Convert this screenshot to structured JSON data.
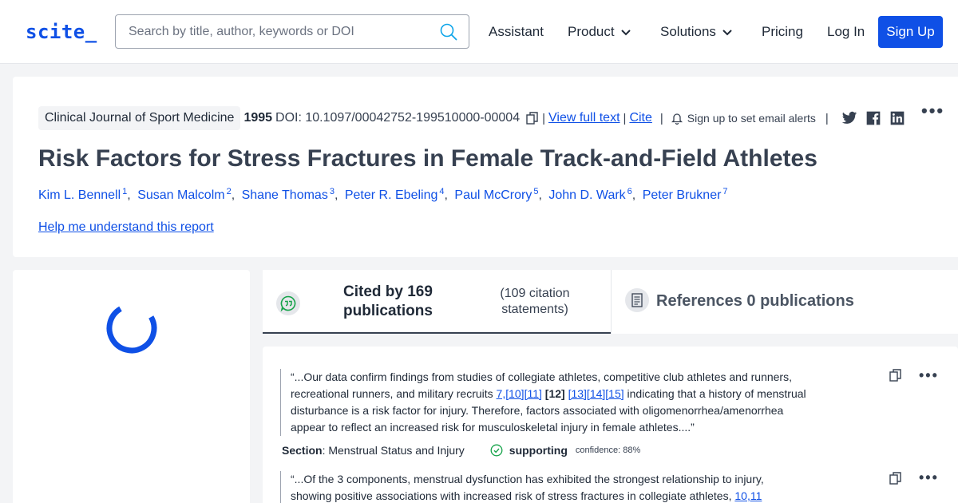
{
  "header": {
    "logo": "scite_",
    "search_placeholder": "Search by title, author, keywords or DOI",
    "nav": {
      "assistant": "Assistant",
      "product": "Product",
      "solutions": "Solutions",
      "pricing": "Pricing",
      "login": "Log In",
      "signup": "Sign Up"
    },
    "brand_color": "#0f50e6"
  },
  "article": {
    "journal": "Clinical Journal of Sport Medicine",
    "year": "1995",
    "doi": "DOI: 10.1097/00042752-199510000-00004",
    "view_full_text": "View full text",
    "cite": "Cite",
    "email_alerts": "Sign up to set email alerts",
    "title": "Risk Factors for Stress Fractures in Female Track-and-Field Athletes",
    "authors": [
      {
        "name": "Kim L. Bennell",
        "num": "1"
      },
      {
        "name": "Susan Malcolm",
        "num": "2"
      },
      {
        "name": "Shane Thomas",
        "num": "3"
      },
      {
        "name": "Peter R. Ebeling",
        "num": "4"
      },
      {
        "name": "Paul McCrory",
        "num": "5"
      },
      {
        "name": "John D. Wark",
        "num": "6"
      },
      {
        "name": "Peter Brukner",
        "num": "7"
      }
    ],
    "help_link": "Help me understand this report"
  },
  "tabs": {
    "cited_by": "Cited by 169 publications",
    "citation_statements": "(109 citation statements)",
    "references": "References 0 publications"
  },
  "statements": [
    {
      "part1": "“...Our data confirm findings from studies of collegiate athletes, competitive club athletes and runners, recreational runners, and military recruits ",
      "refs_a": "7,[10][11]",
      "ref_bold": "[12]",
      "refs_b": "[13][14][15]",
      "part2": " indicating that a history of menstrual disturbance is a risk factor for injury. Therefore, factors associated with oligomenorrhea/amenorrhea appear to reflect an increased risk for musculoskeletal injury in female athletes....”",
      "section_label": "Section",
      "section_value": ": Menstrual Status and Injury",
      "classification": "supporting",
      "confidence": "confidence: 88%"
    },
    {
      "part1": "“...Of the 3 components, menstrual dysfunction has exhibited the strongest relationship to injury, showing positive associations with increased risk of stress fractures in collegiate athletes, ",
      "refs_a": "10,11"
    }
  ]
}
